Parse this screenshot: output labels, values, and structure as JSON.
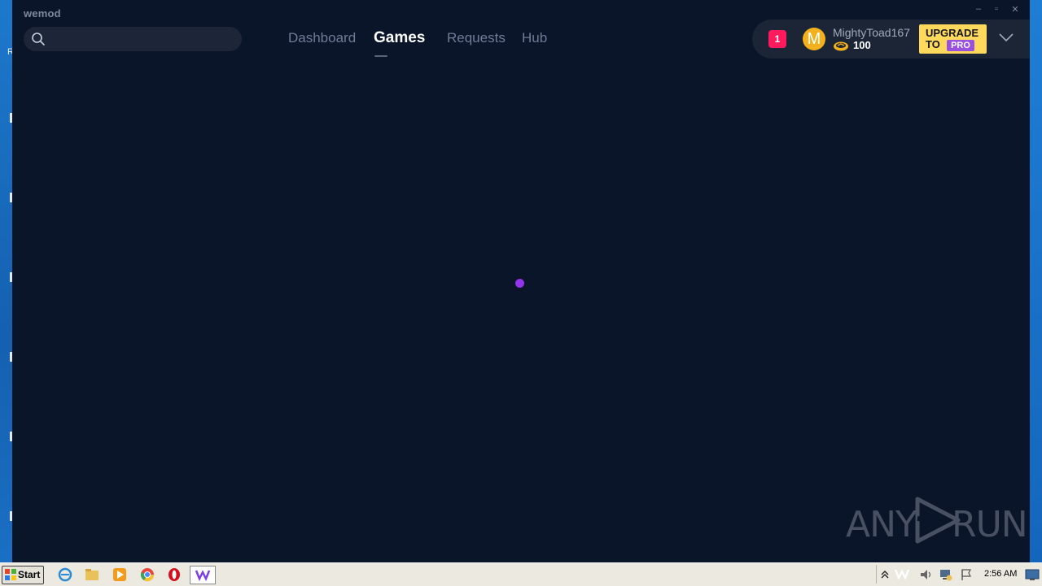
{
  "app": {
    "title": "wemod",
    "window_controls": [
      "–",
      "▫",
      "✕"
    ]
  },
  "search": {
    "placeholder": ""
  },
  "nav": {
    "items": [
      {
        "label": "Dashboard",
        "active": false
      },
      {
        "label": "Games",
        "active": true
      },
      {
        "label": "Requests",
        "active": false
      },
      {
        "label": "Hub",
        "active": false
      }
    ]
  },
  "header": {
    "notification_count": "1",
    "avatar_letter": "M",
    "username": "MightyToad167",
    "coins": "100",
    "upgrade_line1": "UPGRADE",
    "upgrade_line2": "TO",
    "upgrade_pro": "PRO"
  },
  "watermark": {
    "text_left": "ANY",
    "text_right": "RUN"
  },
  "taskbar": {
    "start_label": "Start",
    "clock": "2:56 AM"
  },
  "colors": {
    "background": "#0b152a",
    "accent_purple": "#9333ea",
    "notif_red": "#ff1a5e",
    "upgrade_yellow": "#fed95c",
    "avatar_gold": "#f3b21d"
  }
}
